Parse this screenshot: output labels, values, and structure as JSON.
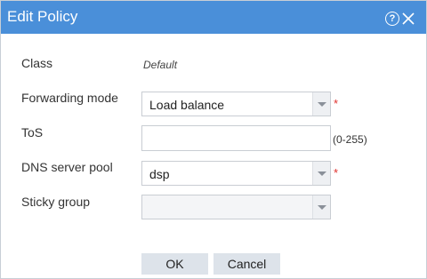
{
  "dialog": {
    "title": "Edit Policy",
    "help_icon": "question-circle-icon",
    "close_icon": "close-icon"
  },
  "form": {
    "class": {
      "label": "Class",
      "value": "Default"
    },
    "forwarding_mode": {
      "label": "Forwarding mode",
      "value": "Load balance",
      "required_mark": "*"
    },
    "tos": {
      "label": "ToS",
      "value": "",
      "range_hint": "(0-255)"
    },
    "dns_server_pool": {
      "label": "DNS server pool",
      "value": "dsp",
      "required_mark": "*"
    },
    "sticky_group": {
      "label": "Sticky group",
      "value": ""
    }
  },
  "buttons": {
    "ok_label": "OK",
    "cancel_label": "Cancel"
  },
  "colors": {
    "titlebar": "#4a8fd9",
    "required": "#e0302d",
    "button_bg": "#dde3ea"
  }
}
